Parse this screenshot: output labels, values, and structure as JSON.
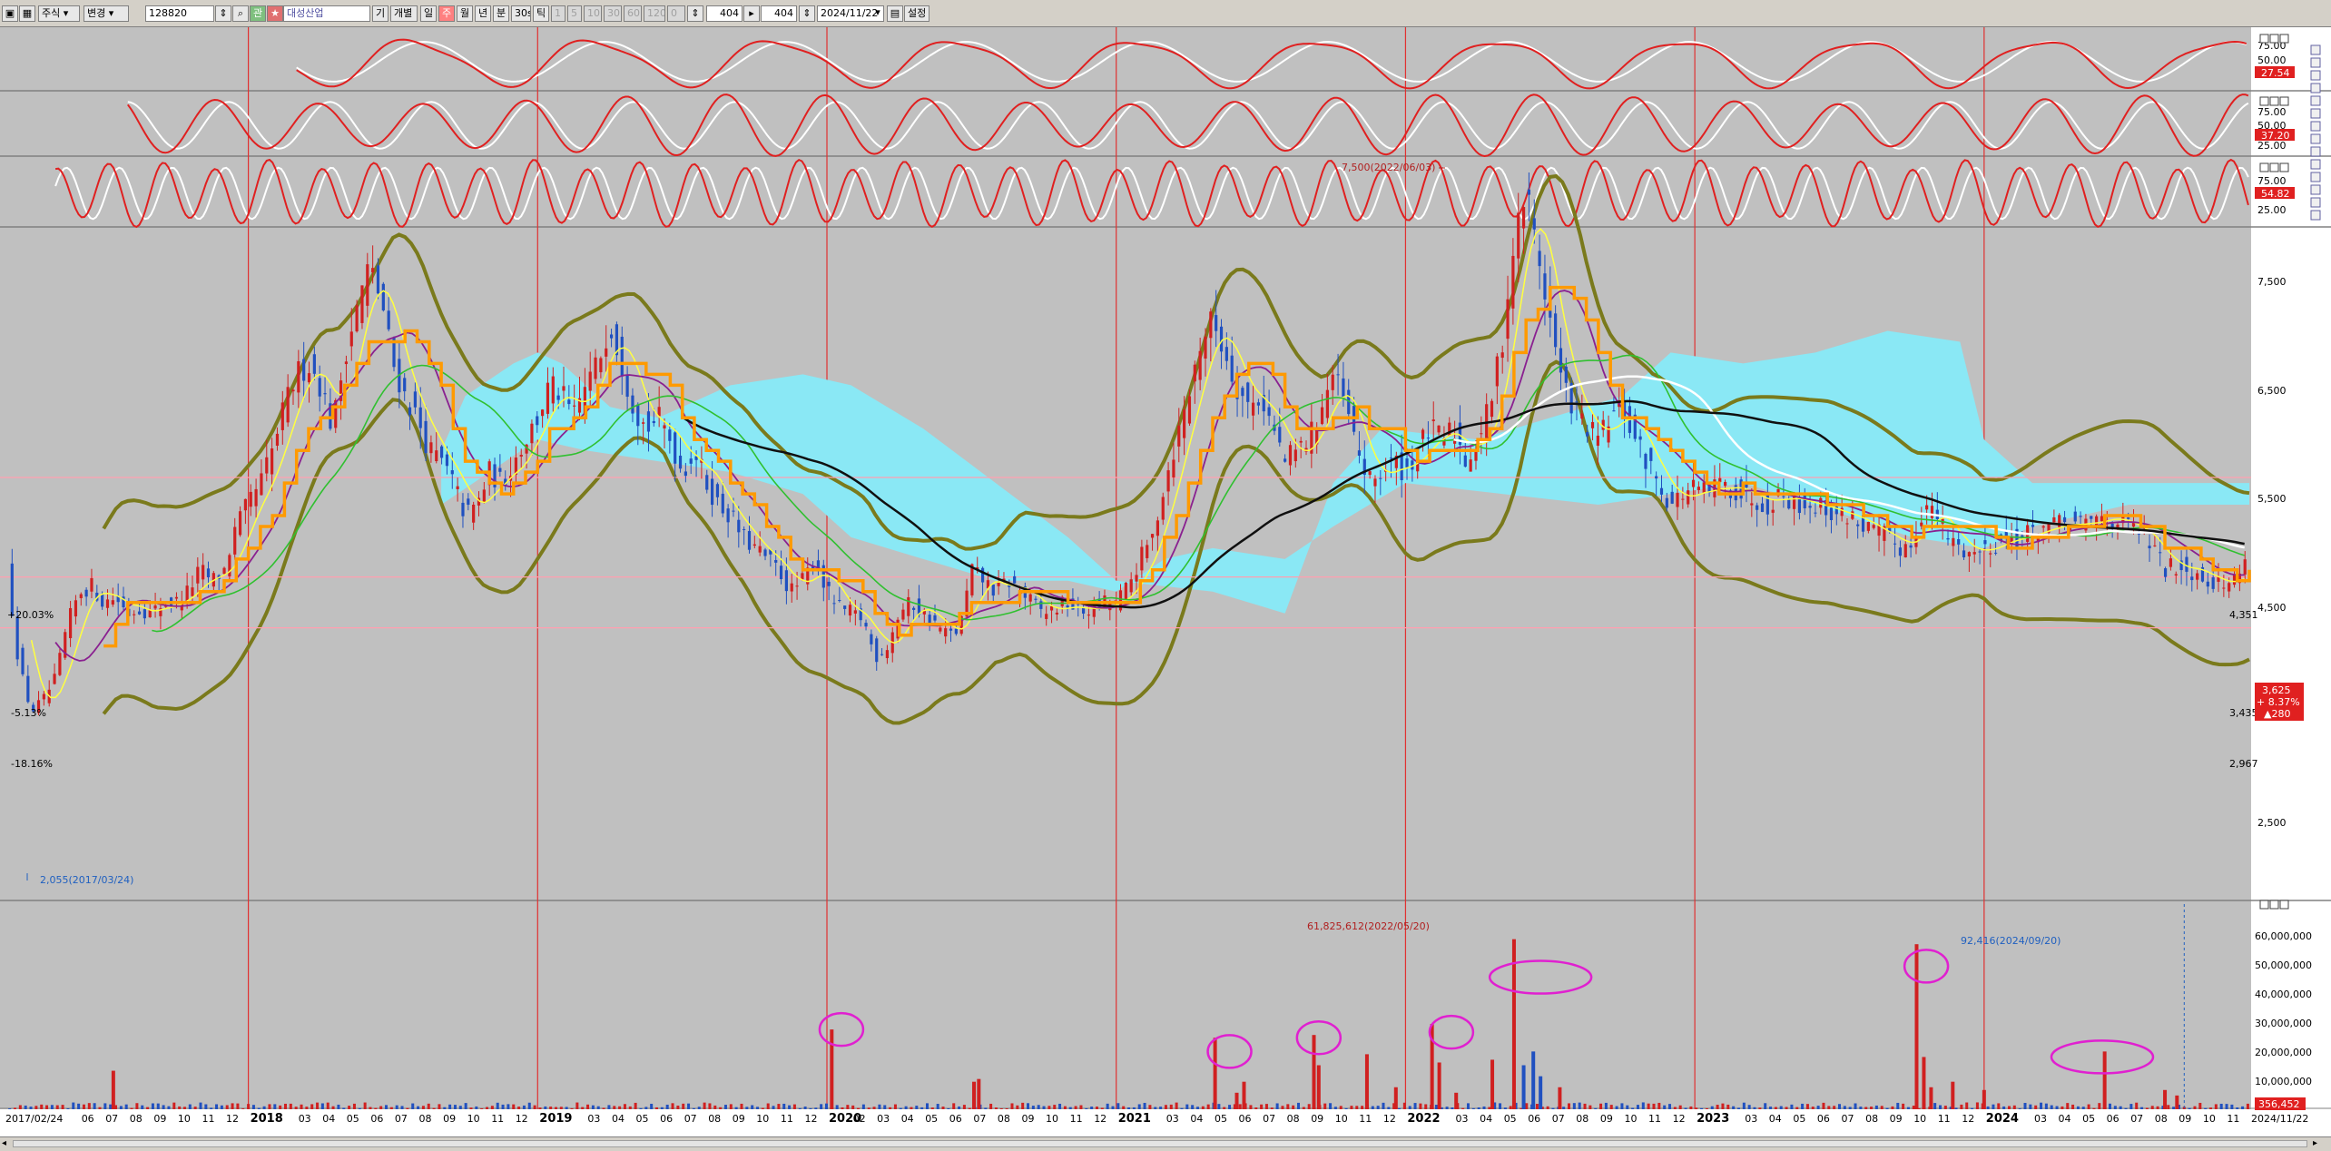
{
  "toolbar": {
    "market_select": "주식",
    "mode_select": "변경",
    "stock_code": "128820",
    "stock_name": "대성산업",
    "period_label_1": "기",
    "period_label_2": "개별",
    "tabs": [
      "일",
      "주",
      "월",
      "년",
      "분",
      "30s",
      "틱"
    ],
    "minute_options": [
      "1",
      "5",
      "10",
      "30",
      "60",
      "120",
      "0"
    ],
    "count_1": "404",
    "count_2": "404",
    "date": "2024/11/22",
    "settings_label": "설정"
  },
  "price_axis": {
    "ticks": [
      "7,500",
      "6,500",
      "5,500",
      "4,500",
      "2,500"
    ],
    "level_labels": [
      "4,351",
      "3,435",
      "2,967"
    ],
    "current_price": "3,625",
    "change_pct": "+ 8.37%",
    "change_abs": "▲280",
    "left_pct_labels": [
      "+20.03%",
      "-5.13%",
      "-18.16%"
    ],
    "max_annotation": "7,500(2022/06/03)",
    "min_annotation": "2,055(2017/03/24)"
  },
  "volume_axis": {
    "ticks": [
      "60,000,000",
      "50,000,000",
      "40,000,000",
      "30,000,000",
      "20,000,000",
      "10,000,000"
    ],
    "current": "356,452",
    "max_annotation": "61,825,612(2022/05/20)",
    "mark_annotation": "92,416(2024/09/20)"
  },
  "osc_panels": [
    {
      "ticks": [
        "75.00",
        "50.00"
      ],
      "value": "27.54"
    },
    {
      "ticks": [
        "75.00",
        "50.00",
        "25.00"
      ],
      "value": "37.20"
    },
    {
      "ticks": [
        "75.00",
        "25.00"
      ],
      "value": "54.82"
    }
  ],
  "time_axis": {
    "labels": [
      {
        "t": "2017/02/24",
        "m": 0
      },
      {
        "t": "06",
        "m": 3
      },
      {
        "t": "07",
        "m": 4
      },
      {
        "t": "08",
        "m": 5
      },
      {
        "t": "09",
        "m": 6
      },
      {
        "t": "10",
        "m": 7
      },
      {
        "t": "11",
        "m": 8
      },
      {
        "t": "12",
        "m": 9
      },
      {
        "t": "2018",
        "m": 10,
        "y": true
      },
      {
        "t": "03",
        "m": 12
      },
      {
        "t": "04",
        "m": 13
      },
      {
        "t": "05",
        "m": 14
      },
      {
        "t": "06",
        "m": 15
      },
      {
        "t": "07",
        "m": 16
      },
      {
        "t": "08",
        "m": 17
      },
      {
        "t": "09",
        "m": 18
      },
      {
        "t": "10",
        "m": 19
      },
      {
        "t": "11",
        "m": 20
      },
      {
        "t": "12",
        "m": 21
      },
      {
        "t": "2019",
        "m": 22,
        "y": true
      },
      {
        "t": "03",
        "m": 24
      },
      {
        "t": "04",
        "m": 25
      },
      {
        "t": "05",
        "m": 26
      },
      {
        "t": "06",
        "m": 27
      },
      {
        "t": "07",
        "m": 28
      },
      {
        "t": "08",
        "m": 29
      },
      {
        "t": "09",
        "m": 30
      },
      {
        "t": "10",
        "m": 31
      },
      {
        "t": "11",
        "m": 32
      },
      {
        "t": "12",
        "m": 33
      },
      {
        "t": "2020",
        "m": 34,
        "y": true
      },
      {
        "t": "02",
        "m": 35
      },
      {
        "t": "03",
        "m": 36
      },
      {
        "t": "04",
        "m": 37
      },
      {
        "t": "05",
        "m": 38
      },
      {
        "t": "06",
        "m": 39
      },
      {
        "t": "07",
        "m": 40
      },
      {
        "t": "08",
        "m": 41
      },
      {
        "t": "09",
        "m": 42
      },
      {
        "t": "10",
        "m": 43
      },
      {
        "t": "11",
        "m": 44
      },
      {
        "t": "12",
        "m": 45
      },
      {
        "t": "2021",
        "m": 46,
        "y": true
      },
      {
        "t": "03",
        "m": 48
      },
      {
        "t": "04",
        "m": 49
      },
      {
        "t": "05",
        "m": 50
      },
      {
        "t": "06",
        "m": 51
      },
      {
        "t": "07",
        "m": 52
      },
      {
        "t": "08",
        "m": 53
      },
      {
        "t": "09",
        "m": 54
      },
      {
        "t": "10",
        "m": 55
      },
      {
        "t": "11",
        "m": 56
      },
      {
        "t": "12",
        "m": 57
      },
      {
        "t": "2022",
        "m": 58,
        "y": true
      },
      {
        "t": "03",
        "m": 60
      },
      {
        "t": "04",
        "m": 61
      },
      {
        "t": "05",
        "m": 62
      },
      {
        "t": "06",
        "m": 63
      },
      {
        "t": "07",
        "m": 64
      },
      {
        "t": "08",
        "m": 65
      },
      {
        "t": "09",
        "m": 66
      },
      {
        "t": "10",
        "m": 67
      },
      {
        "t": "11",
        "m": 68
      },
      {
        "t": "12",
        "m": 69
      },
      {
        "t": "2023",
        "m": 70,
        "y": true
      },
      {
        "t": "03",
        "m": 72
      },
      {
        "t": "04",
        "m": 73
      },
      {
        "t": "05",
        "m": 74
      },
      {
        "t": "06",
        "m": 75
      },
      {
        "t": "07",
        "m": 76
      },
      {
        "t": "08",
        "m": 77
      },
      {
        "t": "09",
        "m": 78
      },
      {
        "t": "10",
        "m": 79
      },
      {
        "t": "11",
        "m": 80
      },
      {
        "t": "12",
        "m": 81
      },
      {
        "t": "2024",
        "m": 82,
        "y": true
      },
      {
        "t": "03",
        "m": 84
      },
      {
        "t": "04",
        "m": 85
      },
      {
        "t": "05",
        "m": 86
      },
      {
        "t": "06",
        "m": 87
      },
      {
        "t": "07",
        "m": 88
      },
      {
        "t": "08",
        "m": 89
      },
      {
        "t": "09",
        "m": 90
      },
      {
        "t": "10",
        "m": 91
      },
      {
        "t": "11",
        "m": 92
      }
    ],
    "end_label": "2024/11/22"
  },
  "chart_data": {
    "type": "candlestick",
    "price_range": [
      2000,
      8200
    ],
    "volume_range": [
      0,
      66000000
    ],
    "year_starts_m": [
      10,
      22,
      34,
      46,
      58,
      70,
      82
    ],
    "close_path": [
      [
        0,
        3500
      ],
      [
        0.5,
        2600
      ],
      [
        1,
        2200
      ],
      [
        1.5,
        2300
      ],
      [
        2,
        2500
      ],
      [
        2.5,
        3000
      ],
      [
        3,
        3300
      ],
      [
        3.5,
        3350
      ],
      [
        4,
        3200
      ],
      [
        4.5,
        3250
      ],
      [
        5,
        3100
      ],
      [
        5.5,
        3150
      ],
      [
        6,
        3100
      ],
      [
        6.5,
        3200
      ],
      [
        7,
        3200
      ],
      [
        7.5,
        3300
      ],
      [
        8,
        3500
      ],
      [
        8.5,
        3400
      ],
      [
        9,
        3500
      ],
      [
        9.5,
        3900
      ],
      [
        10,
        4100
      ],
      [
        10.5,
        4300
      ],
      [
        11,
        4600
      ],
      [
        11.5,
        5000
      ],
      [
        12,
        5300
      ],
      [
        12.5,
        5400
      ],
      [
        13,
        5200
      ],
      [
        13.5,
        4800
      ],
      [
        14,
        5500
      ],
      [
        14.5,
        5900
      ],
      [
        15,
        6300
      ],
      [
        15.5,
        6000
      ],
      [
        16,
        5400
      ],
      [
        16.5,
        5100
      ],
      [
        17,
        4900
      ],
      [
        17.5,
        4600
      ],
      [
        18,
        4500
      ],
      [
        18.5,
        4300
      ],
      [
        19,
        4000
      ],
      [
        19.5,
        4100
      ],
      [
        20,
        4400
      ],
      [
        20.5,
        4300
      ],
      [
        21,
        4500
      ],
      [
        21.5,
        4700
      ],
      [
        22,
        4900
      ],
      [
        22.5,
        5200
      ],
      [
        23,
        5100
      ],
      [
        23.5,
        4900
      ],
      [
        24,
        5200
      ],
      [
        24.5,
        5400
      ],
      [
        25,
        5800
      ],
      [
        25.5,
        5400
      ],
      [
        26,
        5000
      ],
      [
        26.5,
        4800
      ],
      [
        27,
        4900
      ],
      [
        27.5,
        4700
      ],
      [
        28,
        4400
      ],
      [
        28.5,
        4600
      ],
      [
        29,
        4300
      ],
      [
        29.5,
        4100
      ],
      [
        30,
        4000
      ],
      [
        30.5,
        3800
      ],
      [
        31,
        3700
      ],
      [
        31.5,
        3600
      ],
      [
        32,
        3500
      ],
      [
        32.5,
        3300
      ],
      [
        33,
        3400
      ],
      [
        33.5,
        3600
      ],
      [
        34,
        3300
      ],
      [
        34.5,
        3150
      ],
      [
        35,
        3100
      ],
      [
        35.5,
        3050
      ],
      [
        36,
        2700
      ],
      [
        36.5,
        2800
      ],
      [
        37,
        3100
      ],
      [
        37.5,
        3200
      ],
      [
        38,
        3100
      ],
      [
        38.5,
        3000
      ],
      [
        39,
        2900
      ],
      [
        39.5,
        2950
      ],
      [
        40,
        3500
      ],
      [
        40.5,
        3400
      ],
      [
        41,
        3300
      ],
      [
        41.5,
        3400
      ],
      [
        42,
        3300
      ],
      [
        42.5,
        3200
      ],
      [
        43,
        3100
      ],
      [
        43.5,
        3150
      ],
      [
        44,
        3200
      ],
      [
        44.5,
        3100
      ],
      [
        45,
        3150
      ],
      [
        45.5,
        3200
      ],
      [
        46,
        3200
      ],
      [
        46.5,
        3350
      ],
      [
        47,
        3600
      ],
      [
        47.5,
        3800
      ],
      [
        48,
        4300
      ],
      [
        48.5,
        4700
      ],
      [
        49,
        5100
      ],
      [
        49.5,
        5600
      ],
      [
        50,
        5800
      ],
      [
        50.5,
        5500
      ],
      [
        51,
        5200
      ],
      [
        51.5,
        5000
      ],
      [
        52,
        5100
      ],
      [
        52.5,
        4800
      ],
      [
        53,
        4500
      ],
      [
        53.5,
        4600
      ],
      [
        54,
        4700
      ],
      [
        54.5,
        5000
      ],
      [
        55,
        5300
      ],
      [
        55.5,
        5000
      ],
      [
        56,
        4600
      ],
      [
        56.5,
        4300
      ],
      [
        57,
        4400
      ],
      [
        57.5,
        4500
      ],
      [
        58,
        4400
      ],
      [
        58.5,
        4600
      ],
      [
        59,
        4800
      ],
      [
        59.5,
        4700
      ],
      [
        60,
        4800
      ],
      [
        60.5,
        4500
      ],
      [
        61,
        4700
      ],
      [
        61.5,
        5000
      ],
      [
        62,
        5600
      ],
      [
        62.5,
        6500
      ],
      [
        63,
        7000
      ],
      [
        63.5,
        6400
      ],
      [
        64,
        5800
      ],
      [
        64.5,
        5200
      ],
      [
        65,
        5000
      ],
      [
        65.5,
        4800
      ],
      [
        66,
        4700
      ],
      [
        66.5,
        4900
      ],
      [
        67,
        5000
      ],
      [
        67.5,
        4700
      ],
      [
        68,
        4500
      ],
      [
        68.5,
        4300
      ],
      [
        69,
        4100
      ],
      [
        69.5,
        4200
      ],
      [
        70,
        4250
      ],
      [
        70.5,
        4200
      ],
      [
        71,
        4300
      ],
      [
        71.5,
        4250
      ],
      [
        72,
        4200
      ],
      [
        72.5,
        4150
      ],
      [
        73,
        4100
      ],
      [
        73.5,
        4200
      ],
      [
        74,
        4150
      ],
      [
        74.5,
        4100
      ],
      [
        75,
        4100
      ],
      [
        75.5,
        4050
      ],
      [
        76,
        4000
      ],
      [
        76.5,
        4000
      ],
      [
        77,
        3900
      ],
      [
        77.5,
        3850
      ],
      [
        78,
        3800
      ],
      [
        78.5,
        3700
      ],
      [
        79,
        3750
      ],
      [
        79.5,
        4100
      ],
      [
        80,
        4000
      ],
      [
        80.5,
        3800
      ],
      [
        81,
        3700
      ],
      [
        81.5,
        3650
      ],
      [
        82,
        3700
      ],
      [
        82.5,
        3750
      ],
      [
        83,
        3800
      ],
      [
        83.5,
        3800
      ],
      [
        84,
        3850
      ],
      [
        84.5,
        3900
      ],
      [
        85,
        3900
      ],
      [
        85.5,
        3950
      ],
      [
        86,
        3900
      ],
      [
        86.5,
        3950
      ],
      [
        87,
        4000
      ],
      [
        87.5,
        3950
      ],
      [
        88,
        3900
      ],
      [
        88.5,
        3850
      ],
      [
        89,
        3700
      ],
      [
        89.5,
        3500
      ],
      [
        90,
        3550
      ],
      [
        90.5,
        3500
      ],
      [
        91,
        3450
      ],
      [
        91.5,
        3400
      ],
      [
        92,
        3350
      ],
      [
        92.5,
        3450
      ],
      [
        93,
        3625
      ]
    ],
    "volume_spikes": [
      [
        4.4,
        14000000
      ],
      [
        34.2,
        29000000
      ],
      [
        40.1,
        10000000
      ],
      [
        40.3,
        11000000
      ],
      [
        50.1,
        26000000
      ],
      [
        51.0,
        6000000
      ],
      [
        51.3,
        10000000
      ],
      [
        54.2,
        27000000
      ],
      [
        54.4,
        16000000
      ],
      [
        56.4,
        20000000
      ],
      [
        57.6,
        8000000
      ],
      [
        59.1,
        31000000
      ],
      [
        59.4,
        17000000
      ],
      [
        60.1,
        6000000
      ],
      [
        61.6,
        18000000
      ],
      [
        62.5,
        61825612
      ],
      [
        62.9,
        16000000
      ],
      [
        63.3,
        21000000
      ],
      [
        63.6,
        12000000
      ],
      [
        64.4,
        8000000
      ],
      [
        79.2,
        60000000
      ],
      [
        79.5,
        19000000
      ],
      [
        79.8,
        8000000
      ],
      [
        80.7,
        10000000
      ],
      [
        82.0,
        7000000
      ],
      [
        87.0,
        21000000
      ],
      [
        89.5,
        7000000
      ],
      [
        90.0,
        5000000
      ]
    ],
    "circled_m": [
      [
        34.6,
        29000000,
        "s"
      ],
      [
        50.7,
        21000000,
        "s"
      ],
      [
        54.4,
        26000000,
        "s"
      ],
      [
        59.9,
        28000000,
        "s"
      ],
      [
        63.6,
        48000000,
        "w"
      ],
      [
        79.6,
        52000000,
        "s"
      ],
      [
        86.9,
        19000000,
        "w"
      ]
    ],
    "level_lines": [
      4351,
      3435,
      2967
    ]
  }
}
